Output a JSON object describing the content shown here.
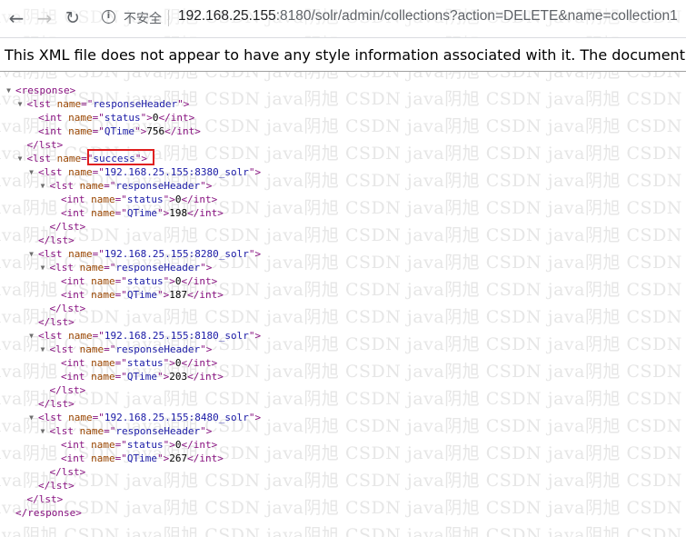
{
  "browser": {
    "security_label": "不安全",
    "url_host": "192.168.25.155",
    "url_rest": ":8180/solr/admin/collections?action=DELETE&name=collection1"
  },
  "banner_text": "This XML file does not appear to have any style information associated with it. The document tree",
  "watermark": "ava阴旭 CSDN java阴旭 CSDN java阴旭 CSDN java阴旭 CSDN java阴旭 CSDN java阴旭 CSDN java阴旭",
  "xml_lines": [
    {
      "depth": 0,
      "toggle": true,
      "parts": [
        [
          "tg",
          "<response>"
        ]
      ]
    },
    {
      "depth": 1,
      "toggle": true,
      "parts": [
        [
          "tg",
          "<lst "
        ],
        [
          "an",
          "name"
        ],
        [
          "tg",
          "=\""
        ],
        [
          "av",
          "responseHeader"
        ],
        [
          "tg",
          "\">"
        ]
      ]
    },
    {
      "depth": 2,
      "toggle": false,
      "parts": [
        [
          "tg",
          "<int "
        ],
        [
          "an",
          "name"
        ],
        [
          "tg",
          "=\""
        ],
        [
          "av",
          "status"
        ],
        [
          "tg",
          "\">"
        ],
        [
          "tx",
          "0"
        ],
        [
          "tg",
          "</int>"
        ]
      ]
    },
    {
      "depth": 2,
      "toggle": false,
      "parts": [
        [
          "tg",
          "<int "
        ],
        [
          "an",
          "name"
        ],
        [
          "tg",
          "=\""
        ],
        [
          "av",
          "QTime"
        ],
        [
          "tg",
          "\">"
        ],
        [
          "tx",
          "756"
        ],
        [
          "tg",
          "</int>"
        ]
      ]
    },
    {
      "depth": 1,
      "toggle": false,
      "parts": [
        [
          "tg",
          "</lst>"
        ]
      ]
    },
    {
      "depth": 1,
      "toggle": true,
      "parts": [
        [
          "tg",
          "<lst "
        ],
        [
          "an",
          "name"
        ],
        [
          "tg",
          "=\""
        ],
        [
          "av",
          "success"
        ],
        [
          "tg",
          "\">"
        ]
      ]
    },
    {
      "depth": 2,
      "toggle": true,
      "parts": [
        [
          "tg",
          "<lst "
        ],
        [
          "an",
          "name"
        ],
        [
          "tg",
          "=\""
        ],
        [
          "av",
          "192.168.25.155:8380_solr"
        ],
        [
          "tg",
          "\">"
        ]
      ]
    },
    {
      "depth": 3,
      "toggle": true,
      "parts": [
        [
          "tg",
          "<lst "
        ],
        [
          "an",
          "name"
        ],
        [
          "tg",
          "=\""
        ],
        [
          "av",
          "responseHeader"
        ],
        [
          "tg",
          "\">"
        ]
      ]
    },
    {
      "depth": 4,
      "toggle": false,
      "parts": [
        [
          "tg",
          "<int "
        ],
        [
          "an",
          "name"
        ],
        [
          "tg",
          "=\""
        ],
        [
          "av",
          "status"
        ],
        [
          "tg",
          "\">"
        ],
        [
          "tx",
          "0"
        ],
        [
          "tg",
          "</int>"
        ]
      ]
    },
    {
      "depth": 4,
      "toggle": false,
      "parts": [
        [
          "tg",
          "<int "
        ],
        [
          "an",
          "name"
        ],
        [
          "tg",
          "=\""
        ],
        [
          "av",
          "QTime"
        ],
        [
          "tg",
          "\">"
        ],
        [
          "tx",
          "198"
        ],
        [
          "tg",
          "</int>"
        ]
      ]
    },
    {
      "depth": 3,
      "toggle": false,
      "parts": [
        [
          "tg",
          "</lst>"
        ]
      ]
    },
    {
      "depth": 2,
      "toggle": false,
      "parts": [
        [
          "tg",
          "</lst>"
        ]
      ]
    },
    {
      "depth": 2,
      "toggle": true,
      "parts": [
        [
          "tg",
          "<lst "
        ],
        [
          "an",
          "name"
        ],
        [
          "tg",
          "=\""
        ],
        [
          "av",
          "192.168.25.155:8280_solr"
        ],
        [
          "tg",
          "\">"
        ]
      ]
    },
    {
      "depth": 3,
      "toggle": true,
      "parts": [
        [
          "tg",
          "<lst "
        ],
        [
          "an",
          "name"
        ],
        [
          "tg",
          "=\""
        ],
        [
          "av",
          "responseHeader"
        ],
        [
          "tg",
          "\">"
        ]
      ]
    },
    {
      "depth": 4,
      "toggle": false,
      "parts": [
        [
          "tg",
          "<int "
        ],
        [
          "an",
          "name"
        ],
        [
          "tg",
          "=\""
        ],
        [
          "av",
          "status"
        ],
        [
          "tg",
          "\">"
        ],
        [
          "tx",
          "0"
        ],
        [
          "tg",
          "</int>"
        ]
      ]
    },
    {
      "depth": 4,
      "toggle": false,
      "parts": [
        [
          "tg",
          "<int "
        ],
        [
          "an",
          "name"
        ],
        [
          "tg",
          "=\""
        ],
        [
          "av",
          "QTime"
        ],
        [
          "tg",
          "\">"
        ],
        [
          "tx",
          "187"
        ],
        [
          "tg",
          "</int>"
        ]
      ]
    },
    {
      "depth": 3,
      "toggle": false,
      "parts": [
        [
          "tg",
          "</lst>"
        ]
      ]
    },
    {
      "depth": 2,
      "toggle": false,
      "parts": [
        [
          "tg",
          "</lst>"
        ]
      ]
    },
    {
      "depth": 2,
      "toggle": true,
      "parts": [
        [
          "tg",
          "<lst "
        ],
        [
          "an",
          "name"
        ],
        [
          "tg",
          "=\""
        ],
        [
          "av",
          "192.168.25.155:8180_solr"
        ],
        [
          "tg",
          "\">"
        ]
      ]
    },
    {
      "depth": 3,
      "toggle": true,
      "parts": [
        [
          "tg",
          "<lst "
        ],
        [
          "an",
          "name"
        ],
        [
          "tg",
          "=\""
        ],
        [
          "av",
          "responseHeader"
        ],
        [
          "tg",
          "\">"
        ]
      ]
    },
    {
      "depth": 4,
      "toggle": false,
      "parts": [
        [
          "tg",
          "<int "
        ],
        [
          "an",
          "name"
        ],
        [
          "tg",
          "=\""
        ],
        [
          "av",
          "status"
        ],
        [
          "tg",
          "\">"
        ],
        [
          "tx",
          "0"
        ],
        [
          "tg",
          "</int>"
        ]
      ]
    },
    {
      "depth": 4,
      "toggle": false,
      "parts": [
        [
          "tg",
          "<int "
        ],
        [
          "an",
          "name"
        ],
        [
          "tg",
          "=\""
        ],
        [
          "av",
          "QTime"
        ],
        [
          "tg",
          "\">"
        ],
        [
          "tx",
          "203"
        ],
        [
          "tg",
          "</int>"
        ]
      ]
    },
    {
      "depth": 3,
      "toggle": false,
      "parts": [
        [
          "tg",
          "</lst>"
        ]
      ]
    },
    {
      "depth": 2,
      "toggle": false,
      "parts": [
        [
          "tg",
          "</lst>"
        ]
      ]
    },
    {
      "depth": 2,
      "toggle": true,
      "parts": [
        [
          "tg",
          "<lst "
        ],
        [
          "an",
          "name"
        ],
        [
          "tg",
          "=\""
        ],
        [
          "av",
          "192.168.25.155:8480_solr"
        ],
        [
          "tg",
          "\">"
        ]
      ]
    },
    {
      "depth": 3,
      "toggle": true,
      "parts": [
        [
          "tg",
          "<lst "
        ],
        [
          "an",
          "name"
        ],
        [
          "tg",
          "=\""
        ],
        [
          "av",
          "responseHeader"
        ],
        [
          "tg",
          "\">"
        ]
      ]
    },
    {
      "depth": 4,
      "toggle": false,
      "parts": [
        [
          "tg",
          "<int "
        ],
        [
          "an",
          "name"
        ],
        [
          "tg",
          "=\""
        ],
        [
          "av",
          "status"
        ],
        [
          "tg",
          "\">"
        ],
        [
          "tx",
          "0"
        ],
        [
          "tg",
          "</int>"
        ]
      ]
    },
    {
      "depth": 4,
      "toggle": false,
      "parts": [
        [
          "tg",
          "<int "
        ],
        [
          "an",
          "name"
        ],
        [
          "tg",
          "=\""
        ],
        [
          "av",
          "QTime"
        ],
        [
          "tg",
          "\">"
        ],
        [
          "tx",
          "267"
        ],
        [
          "tg",
          "</int>"
        ]
      ]
    },
    {
      "depth": 3,
      "toggle": false,
      "parts": [
        [
          "tg",
          "</lst>"
        ]
      ]
    },
    {
      "depth": 2,
      "toggle": false,
      "parts": [
        [
          "tg",
          "</lst>"
        ]
      ]
    },
    {
      "depth": 1,
      "toggle": false,
      "parts": [
        [
          "tg",
          "</lst>"
        ]
      ]
    },
    {
      "depth": 0,
      "toggle": false,
      "parts": [
        [
          "tg",
          "</response>"
        ]
      ]
    }
  ]
}
